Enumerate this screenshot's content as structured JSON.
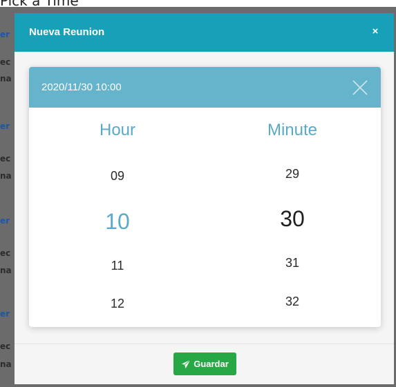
{
  "page": {
    "heading": "Pick a Time"
  },
  "background_list": [
    {
      "text": "er",
      "kind": "link"
    },
    {
      "text": "ec",
      "kind": "text"
    },
    {
      "text": "na",
      "kind": "text"
    },
    {
      "text": "er",
      "kind": "link"
    },
    {
      "text": "ec",
      "kind": "text"
    },
    {
      "text": "na",
      "kind": "text"
    },
    {
      "text": "er",
      "kind": "link"
    },
    {
      "text": "ec",
      "kind": "text"
    },
    {
      "text": "na",
      "kind": "text"
    },
    {
      "text": "er",
      "kind": "link"
    },
    {
      "text": "ec",
      "kind": "text"
    },
    {
      "text": "na",
      "kind": "text"
    }
  ],
  "modal": {
    "title": "Nueva Reunion",
    "close_label": "×",
    "save_label": "Guardar"
  },
  "picker": {
    "value": "2020/11/30 10:00",
    "hour": {
      "title": "Hour",
      "options": [
        "09",
        "10",
        "11",
        "12"
      ],
      "selected": "10"
    },
    "minute": {
      "title": "Minute",
      "options": [
        "29",
        "30",
        "31",
        "32"
      ],
      "selected": "30"
    }
  },
  "colors": {
    "modal_header": "#18a0b8",
    "picker_header": "#66b4cb",
    "accent": "#5aa9c7",
    "save_button": "#28a745"
  }
}
